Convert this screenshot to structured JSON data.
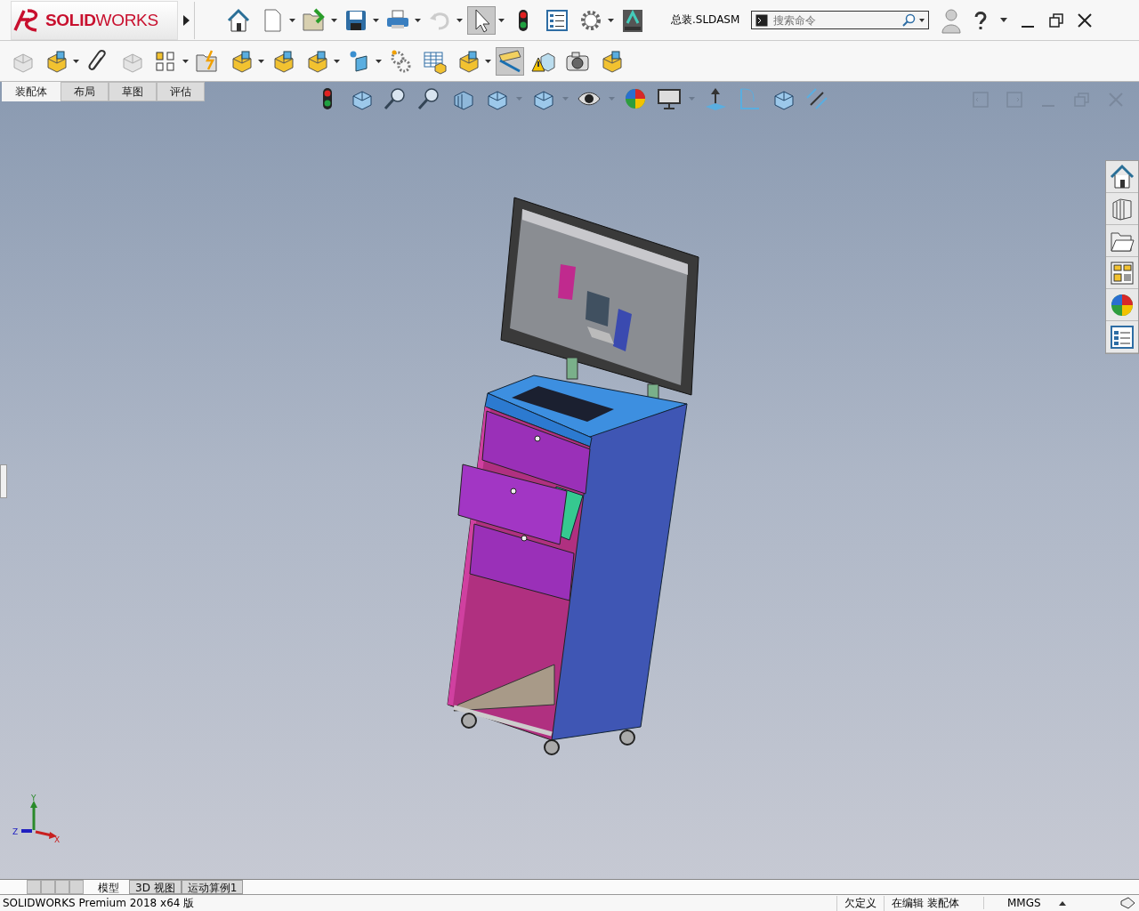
{
  "logo": {
    "strong": "SOLID",
    "light": "WORKS"
  },
  "document_title": "总装.SLDASM",
  "search": {
    "placeholder": "搜索命令"
  },
  "command_tabs": [
    {
      "label": "装配体",
      "selected": true
    },
    {
      "label": "布局",
      "selected": false
    },
    {
      "label": "草图",
      "selected": false
    },
    {
      "label": "评估",
      "selected": false
    }
  ],
  "axes": {
    "x": "X",
    "y": "Y",
    "z": "Z"
  },
  "bottom_tabs": [
    {
      "label": "模型",
      "selected": true
    },
    {
      "label": "3D 视图",
      "selected": false
    },
    {
      "label": "运动算例1",
      "selected": false
    }
  ],
  "status_bar": {
    "product": "SOLIDWORKS Premium 2018 x64 版",
    "definition": "欠定义",
    "editing": "在编辑 装配体",
    "units": "MMGS"
  }
}
